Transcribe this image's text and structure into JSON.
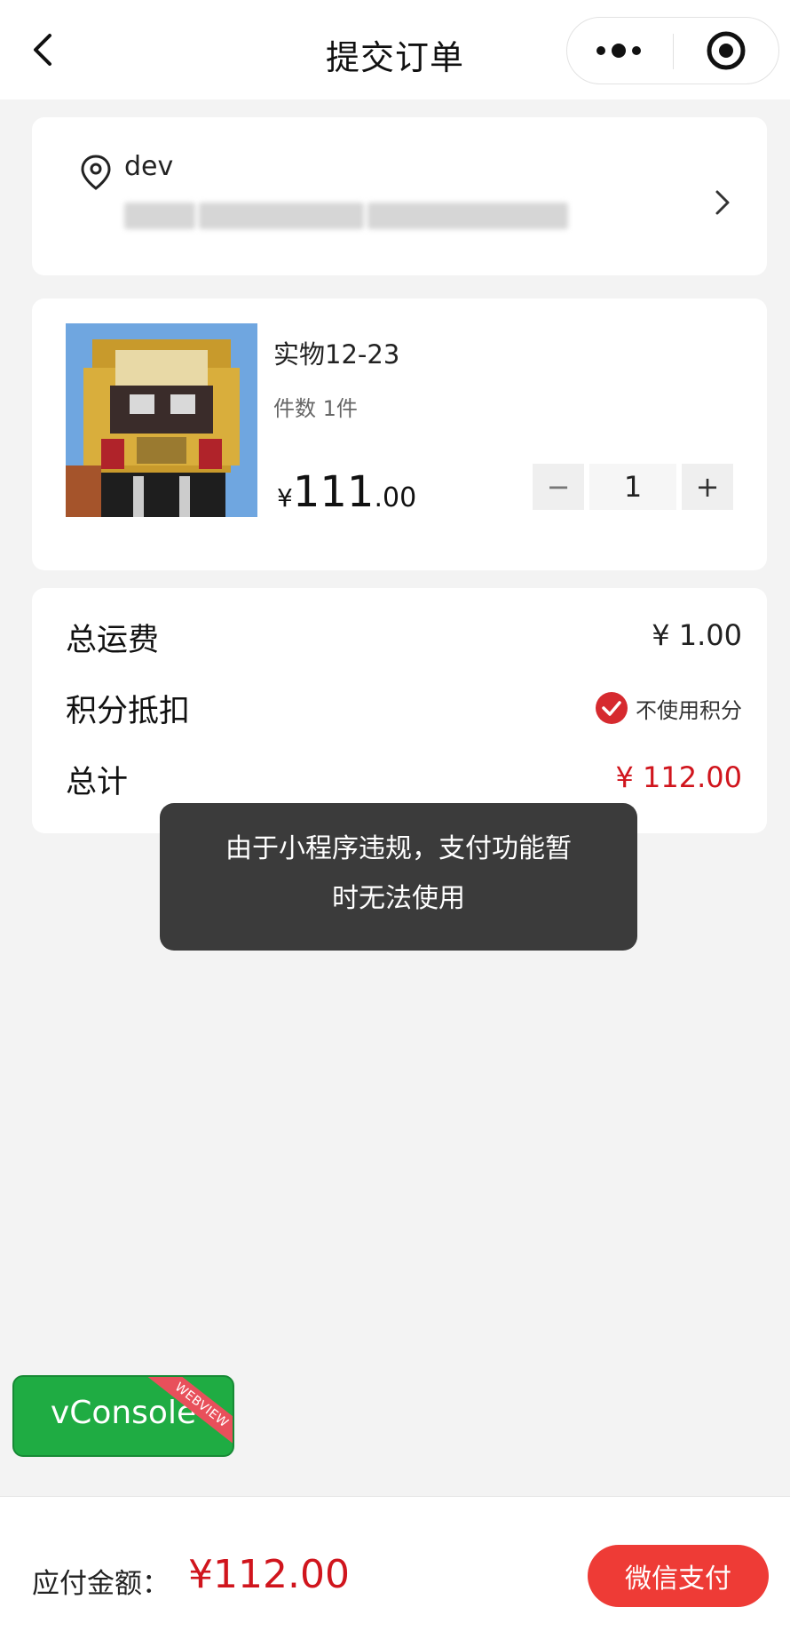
{
  "header": {
    "title": "提交订单",
    "back_icon": "chevron-left-icon",
    "more_icon": "more-dots-icon",
    "close_icon": "target-close-icon"
  },
  "address": {
    "name": "dev",
    "location_icon": "location-pin-icon",
    "arrow_icon": "chevron-right-icon"
  },
  "product": {
    "name": "实物12-23",
    "count_text": "件数 1件",
    "price_symbol": "¥",
    "price_integer": "111",
    "price_decimal": ".00",
    "quantity": "1",
    "minus_label": "−",
    "plus_label": "+"
  },
  "summary": {
    "shipping_label": "总运费",
    "shipping_value": "¥ 1.00",
    "points_label": "积分抵扣",
    "points_option": "不使用积分",
    "total_label": "总计",
    "total_value": "¥ 112.00"
  },
  "toast": {
    "line1": "由于小程序违规，支付功能暂",
    "line2": "时无法使用"
  },
  "vconsole": {
    "label": "vConsole",
    "ribbon": "WEBVIEW"
  },
  "footer": {
    "pay_label": "应付金额：",
    "pay_amount": "¥112.00",
    "pay_button": "微信支付"
  },
  "colors": {
    "accent_red": "#d0151d",
    "pay_button": "#ee3b36",
    "vconsole_green": "#1fac43"
  }
}
